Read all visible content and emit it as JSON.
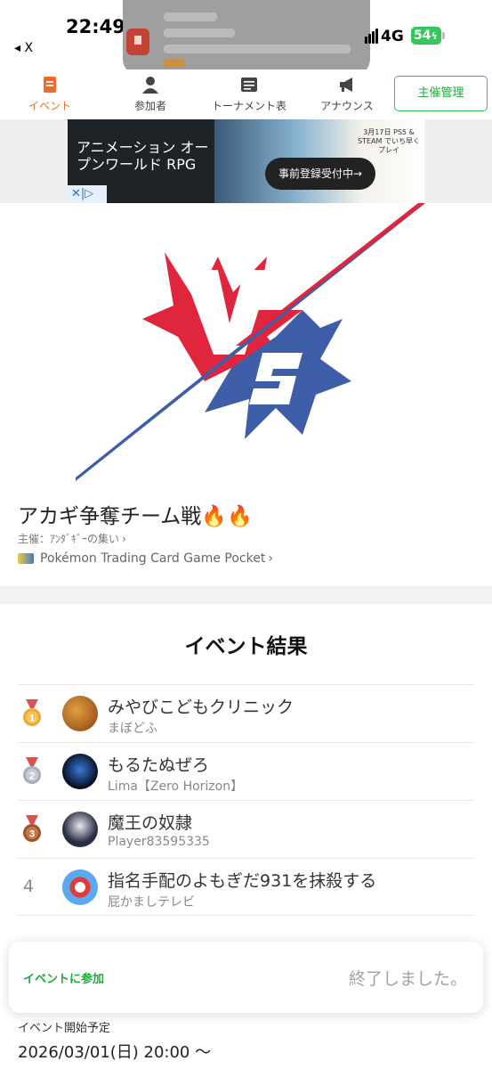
{
  "status_bar": {
    "time": "22:49",
    "back_app": "◂ X",
    "network": "4G",
    "battery": "54"
  },
  "tabs": [
    {
      "label": "イベント",
      "icon": "event-icon",
      "active": true
    },
    {
      "label": "参加者",
      "icon": "person-icon",
      "active": false
    },
    {
      "label": "トーナメント表",
      "icon": "bracket-icon",
      "active": false
    },
    {
      "label": "アナウンス",
      "icon": "megaphone-icon",
      "active": false
    }
  ],
  "organizer_button": "主催管理",
  "ad": {
    "text": "アニメーション オープンワールド RPG",
    "cta": "事前登録受付中→",
    "platform": "3月17日 PS5 & STEAM でいち早くプレイ",
    "badge": "✕|▷"
  },
  "event": {
    "title": "アカギ争奪チーム戦🔥🔥",
    "host": "主催：ｱﾝﾀﾞｷﾞｰの集い",
    "game": "Pokémon Trading Card Game Pocket"
  },
  "results": {
    "title": "イベント結果",
    "rows": [
      {
        "rank": "1",
        "medal": "gold",
        "name": "みやびこどもクリニック",
        "sub": "まぼどふ",
        "avatar_color": "#b5651d"
      },
      {
        "rank": "2",
        "medal": "silver",
        "name": "もるたぬぜろ",
        "sub": "Lima【Zero Horizon】",
        "avatar_color": "#0c1a3a"
      },
      {
        "rank": "3",
        "medal": "bronze",
        "name": "魔王の奴隷",
        "sub": "Player83595335",
        "avatar_color": "#22263a"
      },
      {
        "rank": "4",
        "medal": "none",
        "name": "指名手配のよもぎだ931を抹殺する",
        "sub": "屁かましテレビ",
        "avatar_color": "#3a8fd8"
      }
    ]
  },
  "join": {
    "link": "イベントに参加",
    "status": "終了しました。"
  },
  "start": {
    "label": "イベント開始予定",
    "value": "2026/03/01(日) 20:00 〜"
  },
  "colors": {
    "accent_orange": "#ef6c28",
    "accent_green": "#21a83a",
    "vs_red": "#e0263c",
    "vs_blue": "#3f5ea8"
  }
}
